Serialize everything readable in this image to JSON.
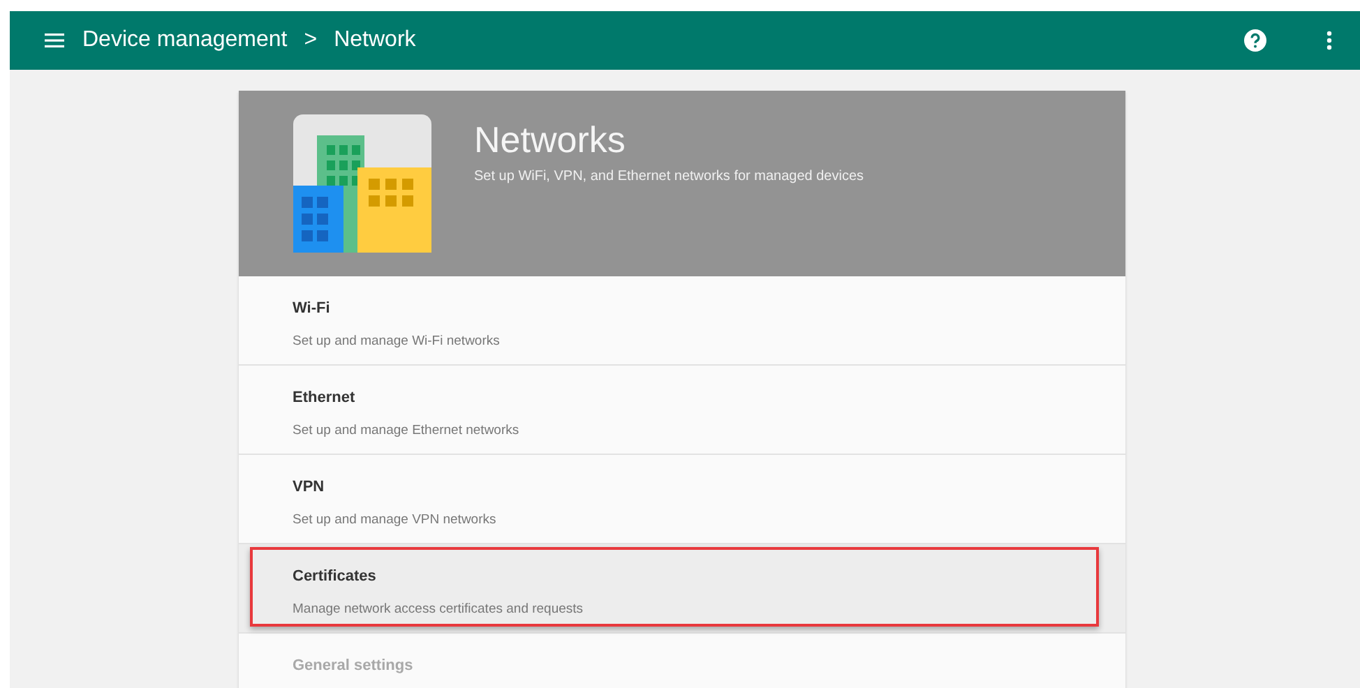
{
  "app_bar": {
    "breadcrumb": [
      "Device management",
      "Network"
    ],
    "separator": ">"
  },
  "header": {
    "title": "Networks",
    "subtitle": "Set up WiFi, VPN, and Ethernet networks for managed devices"
  },
  "items": [
    {
      "title": "Wi-Fi",
      "description": "Set up and manage Wi-Fi networks",
      "selected": false,
      "highlighted": false,
      "faded": false
    },
    {
      "title": "Ethernet",
      "description": "Set up and manage Ethernet networks",
      "selected": false,
      "highlighted": false,
      "faded": false
    },
    {
      "title": "VPN",
      "description": "Set up and manage VPN networks",
      "selected": false,
      "highlighted": false,
      "faded": false
    },
    {
      "title": "Certificates",
      "description": "Manage network access certificates and requests",
      "selected": true,
      "highlighted": true,
      "faded": false
    },
    {
      "title": "General settings",
      "selected": false,
      "highlighted": false,
      "faded": true
    }
  ]
}
